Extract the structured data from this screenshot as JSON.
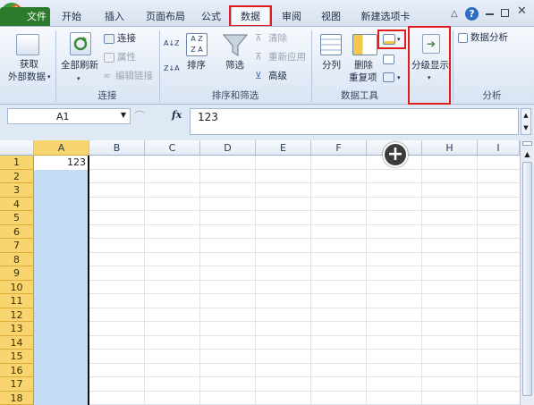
{
  "tabs": [
    {
      "label": "文件",
      "active": false
    },
    {
      "label": "开始",
      "active": false
    },
    {
      "label": "插入",
      "active": false
    },
    {
      "label": "页面布局",
      "active": false
    },
    {
      "label": "公式",
      "active": false
    },
    {
      "label": "数据",
      "active": true
    },
    {
      "label": "审阅",
      "active": false
    },
    {
      "label": "视图",
      "active": false
    },
    {
      "label": "新建选项卡",
      "active": false
    }
  ],
  "ribbon": {
    "get_external": {
      "line1": "获取",
      "line2": "外部数据"
    },
    "connections": {
      "refresh_all": "全部刷新",
      "connections": "连接",
      "properties": "属性",
      "edit_links": "编辑链接",
      "group_label": "连接"
    },
    "sort_filter": {
      "sort": "排序",
      "filter": "筛选",
      "clear": "清除",
      "reapply": "重新应用",
      "advanced": "高级",
      "group_label": "排序和筛选",
      "az": "A↓Z",
      "za": "Z↓A"
    },
    "data_tools": {
      "text_to_columns": "分列",
      "remove_duplicates_1": "删除",
      "remove_duplicates_2": "重复项",
      "group_label": "数据工具"
    },
    "outline": {
      "label": "分级显示"
    },
    "analysis": {
      "data_analysis": "数据分析",
      "group_label": "分析"
    }
  },
  "formula_bar": {
    "name_box": "A1",
    "fx": "fx",
    "value": "123"
  },
  "grid": {
    "columns": [
      "A",
      "B",
      "C",
      "D",
      "E",
      "F",
      "G",
      "H",
      "I"
    ],
    "rows": [
      "1",
      "2",
      "3",
      "4",
      "5",
      "6",
      "7",
      "8",
      "9",
      "10",
      "11",
      "12",
      "13",
      "14",
      "15",
      "16",
      "17",
      "18"
    ],
    "cell_a1": "123"
  },
  "colors": {
    "highlight_red": "#e01b1b",
    "selection_blue": "#c5dcf7",
    "row_header_active": "#f9d56f"
  }
}
